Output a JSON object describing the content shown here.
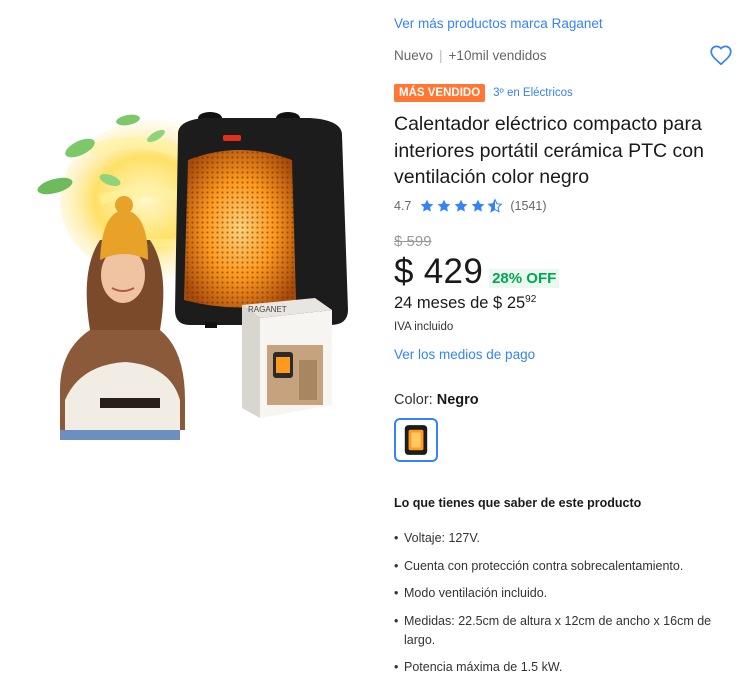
{
  "brand_link": "Ver más productos marca Raganet",
  "condition": "Nuevo",
  "sold": "+10mil vendidos",
  "badge": "MÁS VENDIDO",
  "rank": "3º en Eléctricos",
  "title": "Calentador eléctrico compacto para interiores portátil cerámica PTC con ventilación color negro",
  "rating": {
    "score": "4.7",
    "count": "(1541)",
    "stars": 4.7,
    "star_color": "#3483fa"
  },
  "pricing": {
    "old_price": "$ 599",
    "price": "$ 429",
    "discount": "28% OFF",
    "installments_prefix": "24 meses de $ 25",
    "installments_cents": "92",
    "iva": "IVA incluido",
    "payment_link": "Ver los medios de pago"
  },
  "color": {
    "label": "Color: ",
    "value": "Negro"
  },
  "features_title": "Lo que tienes que saber de este producto",
  "features": [
    "Voltaje: 127V.",
    "Cuenta con protección contra sobrecalentamiento.",
    "Modo ventilación incluido.",
    "Medidas: 22.5cm de altura x 12cm de ancho x 16cm de largo.",
    "Potencia máxima de 1.5 kW."
  ],
  "box_brand": "RAGANET",
  "colors": {
    "link": "#3483fa",
    "badge": "#ff7733",
    "discount": "#00a650",
    "heater_body": "#1c1c1c",
    "heater_glow": "#ff9a1f"
  }
}
